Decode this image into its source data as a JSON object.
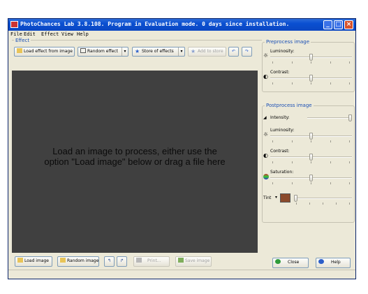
{
  "window": {
    "title": "PhotoChances Lab 3.8.108. Program in Evaluation mode. 0 days since installation.",
    "controls": {
      "minimize": "_",
      "maximize": "□",
      "close": "×"
    }
  },
  "menu": [
    "File",
    "Edit",
    "Effect",
    "View",
    "Help"
  ],
  "effect": {
    "group_label": "Effect",
    "load_effect": "Load effect from image",
    "random_effect": "Random effect",
    "store": "Store of effects",
    "add_to_store": "Add to store"
  },
  "canvas": {
    "message": "Load an image to process, either use the option \"Load image\" below or drag a file here"
  },
  "bottom": {
    "load_image": "Load image",
    "random_image": "Random image",
    "print": "Print...",
    "save_image": "Save image",
    "close": "Close",
    "help": "Help"
  },
  "preprocess": {
    "title": "Preprocess image",
    "sliders": [
      {
        "label": "Luminosity:",
        "icon": "sun-icon",
        "value": 0.5
      },
      {
        "label": "Contrast:",
        "icon": "contrast-icon",
        "value": 0.5
      }
    ]
  },
  "postprocess": {
    "title": "Postprocess image",
    "sliders": [
      {
        "label": "Intensity:",
        "icon": "intensity-icon",
        "value": 1.0
      },
      {
        "label": "Luminosity:",
        "icon": "sun-icon",
        "value": 0.5
      },
      {
        "label": "Contrast:",
        "icon": "contrast-icon",
        "value": 0.5
      },
      {
        "label": "Saturation:",
        "icon": "saturation-icon",
        "value": 0.5
      }
    ],
    "tint": {
      "label": "Tint",
      "color": "#8b4a2b",
      "value": 0.0
    }
  },
  "colors": {
    "titlebar": "#0a4fd1",
    "face": "#ece9d8",
    "canvas": "#404040",
    "group_label": "#1a4fb5"
  }
}
